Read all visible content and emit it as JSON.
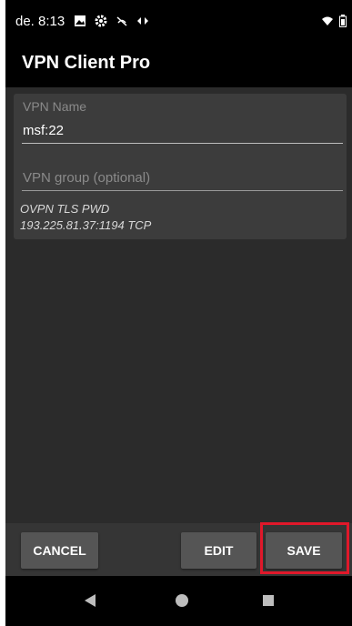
{
  "status_bar": {
    "time": "de. 8:13",
    "icons": [
      "image-icon",
      "gear-icon",
      "signal-off-icon",
      "network-icon"
    ],
    "right_icons": [
      "wifi-icon",
      "battery-icon"
    ]
  },
  "app": {
    "title": "VPN Client Pro"
  },
  "form": {
    "vpn_name_label": "VPN Name",
    "vpn_name_value": "msf:22",
    "vpn_group_placeholder": "VPN group (optional)",
    "info_line1": "OVPN TLS PWD",
    "info_line2": "193.225.81.37:1194 TCP"
  },
  "buttons": {
    "cancel": "CANCEL",
    "edit": "EDIT",
    "save": "SAVE"
  },
  "colors": {
    "background": "#2b2b2b",
    "card": "#3c3c3c",
    "button": "#555555",
    "highlight": "#e0182a"
  }
}
